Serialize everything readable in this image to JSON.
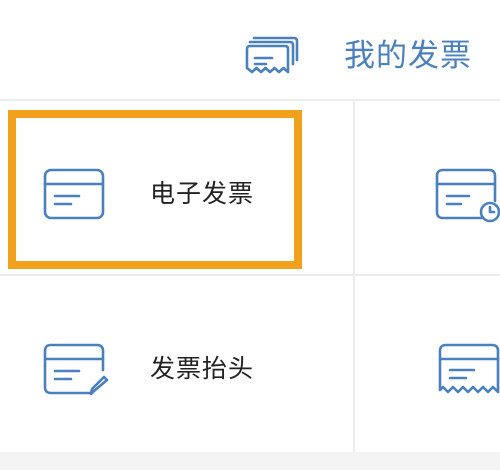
{
  "header": {
    "title": "我的发票",
    "icon": "invoice-stack-icon"
  },
  "accent_color": "#4a80bd",
  "highlight_color": "#f2a11c",
  "grid": {
    "items": [
      {
        "label": "电子发票",
        "icon": "invoice-card-icon"
      },
      {
        "label": "",
        "icon": "invoice-clock-icon"
      },
      {
        "label": "发票抬头",
        "icon": "invoice-edit-icon"
      },
      {
        "label": "",
        "icon": "receipt-icon"
      }
    ]
  }
}
